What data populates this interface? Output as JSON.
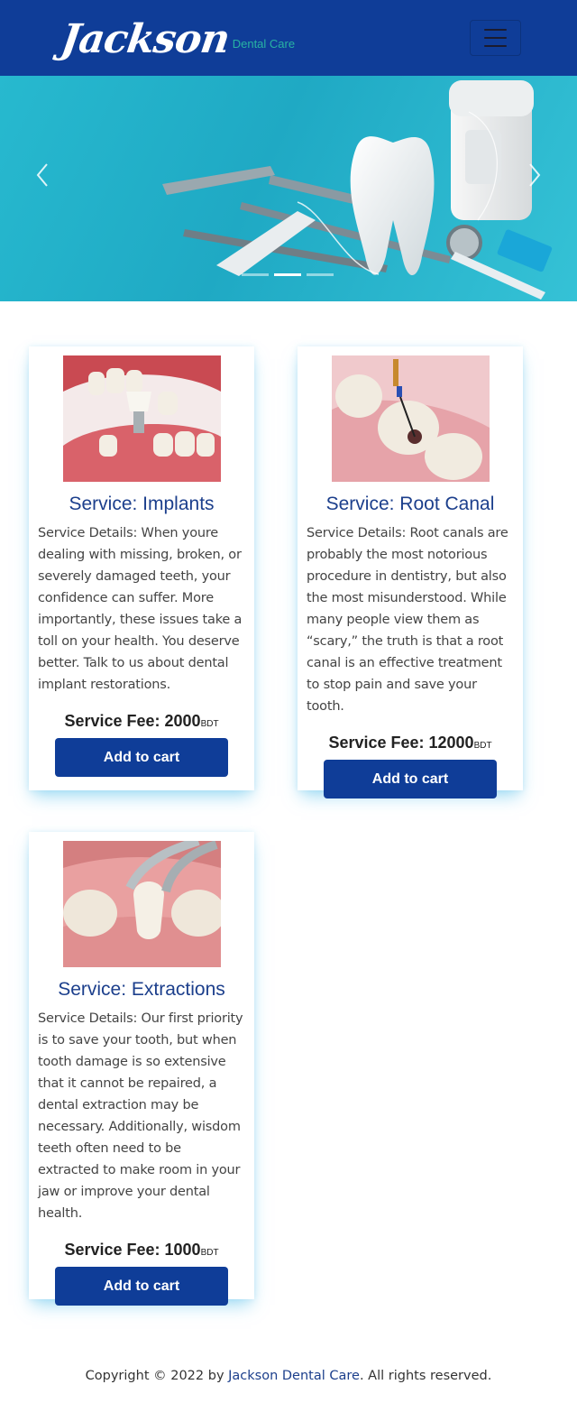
{
  "navbar": {
    "brand_script": "Jackson",
    "brand_sub": "Dental Care"
  },
  "carousel": {
    "slide_count": 3,
    "active_index": 1
  },
  "services": [
    {
      "title": "Service: Implants",
      "details": "Service Details: When youre dealing with missing, broken, or severely damaged teeth, your confidence can suffer. More importantly, these issues take a toll on your health. You deserve better. Talk to us about dental implant restorations.",
      "fee_label": "Service Fee: 2000",
      "currency": "BDT",
      "button_label": "Add to cart"
    },
    {
      "title": "Service: Root Canal",
      "details": "Service Details: Root canals are probably the most notorious procedure in dentistry, but also the most misunderstood. While many people view them as “scary,” the truth is that a root canal is an effective treatment to stop pain and save your tooth.",
      "fee_label": "Service Fee: 12000",
      "currency": "BDT",
      "button_label": "Add to cart"
    },
    {
      "title": "Service: Extractions",
      "details": "Service Details: Our first priority is to save your tooth, but when tooth damage is so extensive that it cannot be repaired, a dental extraction may be necessary. Additionally, wisdom teeth often need to be extracted to make room in your jaw or improve your dental health.",
      "fee_label": "Service Fee: 1000",
      "currency": "BDT",
      "button_label": "Add to cart"
    }
  ],
  "footer": {
    "prefix": "Copyright © 2022 by ",
    "company": "Jackson Dental Care",
    "suffix": ". All rights reserved."
  },
  "colors": {
    "brand_blue": "#0f3d98",
    "title_blue": "#1c3f8c",
    "accent_teal": "#28b3a3"
  }
}
